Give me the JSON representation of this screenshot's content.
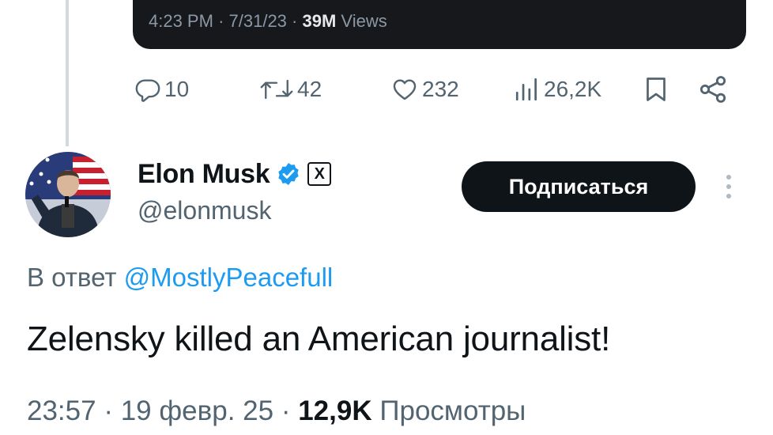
{
  "quoted_tweet": {
    "time": "4:23 PM",
    "date": "7/31/23",
    "views_count": "39M",
    "views_label": "Views"
  },
  "actions": {
    "replies": "10",
    "reposts": "42",
    "likes": "232",
    "views": "26,2K"
  },
  "author": {
    "display_name": "Elon Musk",
    "handle": "@elonmusk",
    "badge": "X"
  },
  "follow_button": "Подписаться",
  "reply": {
    "prefix": "В ответ",
    "mention": "@MostlyPeacefull"
  },
  "tweet": {
    "text": "Zelensky killed an American journalist!",
    "time": "23:57",
    "date": "19 февр. 25",
    "views_count": "12,9K",
    "views_label": "Просмотры"
  },
  "colors": {
    "link": "#1d9bf0",
    "secondary_text": "#536471",
    "button_bg": "#0f1419",
    "verified": "#1d9bf0"
  },
  "icons": [
    "reply-icon",
    "repost-icon",
    "like-icon",
    "views-icon",
    "bookmark-icon",
    "share-icon",
    "verified-icon",
    "more-icon"
  ]
}
